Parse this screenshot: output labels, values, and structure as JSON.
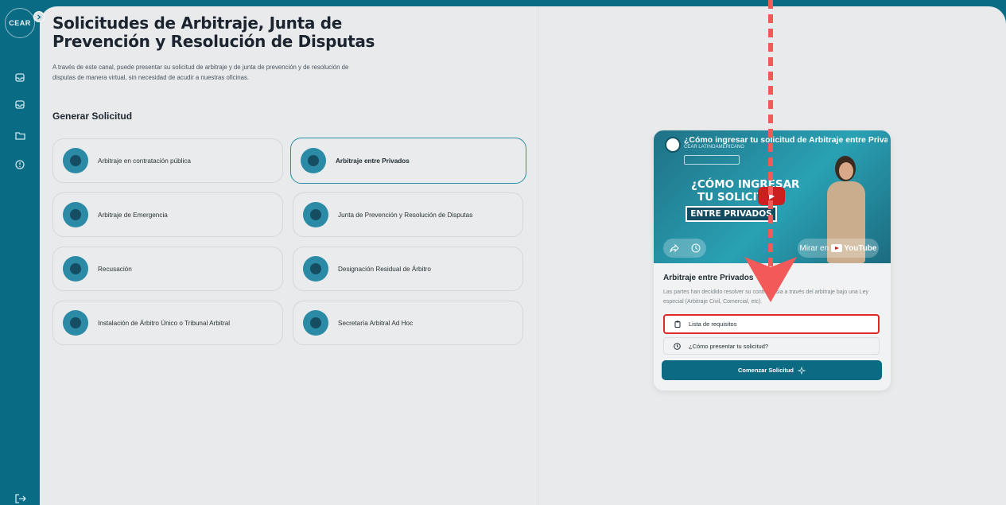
{
  "sidebar": {
    "logo_text": "CEAR",
    "icons": [
      "inbox-icon",
      "inbox-icon",
      "folder-icon",
      "info-icon"
    ],
    "bottom_icon": "logout-icon"
  },
  "page": {
    "title": "Solicitudes de Arbitraje, Junta de Prevención y Resolución de Disputas",
    "intro": "A través de este canal, puede presentar su solicitud de arbitraje y de junta de prevención y de resolución de disputas de manera virtual, sin necesidad de acudir a nuestras oficinas.",
    "section_title": "Generar Solicitud"
  },
  "cards": [
    {
      "label": "Arbitraje en contratación pública",
      "selected": false
    },
    {
      "label": "Arbitraje entre Privados",
      "selected": true
    },
    {
      "label": "Arbitraje de Emergencia",
      "selected": false
    },
    {
      "label": "Junta de Prevención y Resolución de Disputas",
      "selected": false
    },
    {
      "label": "Recusación",
      "selected": false
    },
    {
      "label": "Designación Residual de Árbitro",
      "selected": false
    },
    {
      "label": "Instalación de Árbitro Único o Tribunal Arbitral",
      "selected": false
    },
    {
      "label": "Secretaría Arbitral Ad Hoc",
      "selected": false
    }
  ],
  "video": {
    "title": "¿Cómo ingresar tu solicitud de Arbitraje entre Privados",
    "channel": "CEAR LATINOAMERICANO",
    "line1": "¿CÓMO INGRESAR",
    "line2": "TU SOLICITUD",
    "tag": "ENTRE PRIVADOS",
    "watch_label": "Mirar en",
    "watch_platform": "YouTube"
  },
  "detail": {
    "title": "Arbitraje entre Privados",
    "description": "Las partes han decidido resolver su controversia a través del arbitraje bajo una Ley especial (Arbitraje Civil, Comercial, etc).",
    "requirements_label": "Lista de requisitos",
    "how_label": "¿Cómo presentar tu solicitud?",
    "start_label": "Comenzar Solicitud"
  },
  "colors": {
    "brand": "#0a6b84",
    "accent": "#2a8fa6",
    "highlight": "#e02828",
    "annotation": "#f25a5a"
  }
}
